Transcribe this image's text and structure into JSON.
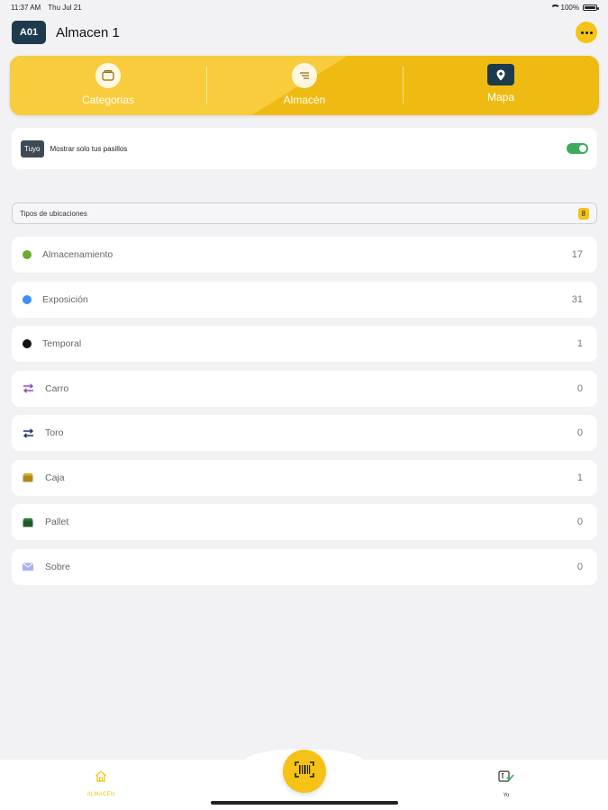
{
  "status_bar": {
    "time": "11:37 AM",
    "date": "Thu Jul 21",
    "battery": "100%"
  },
  "header": {
    "code": "A01",
    "title": "Almacen 1"
  },
  "tabs": [
    {
      "label": "Categorias",
      "icon": "wallet-icon"
    },
    {
      "label": "Almacén",
      "icon": "list-icon"
    },
    {
      "label": "Mapa",
      "icon": "map-pin-icon"
    }
  ],
  "filter": {
    "badge": "Tuyo",
    "label": "Mostrar solo tus pasillos",
    "enabled": true
  },
  "section": {
    "title": "Tipos de ubicaciones",
    "count": "8"
  },
  "location_types": [
    {
      "label": "Almacenamiento",
      "value": "17",
      "icon": "dot",
      "color": "#6aab2e"
    },
    {
      "label": "Exposición",
      "value": "31",
      "icon": "dot",
      "color": "#3d8ff0"
    },
    {
      "label": "Temporal",
      "value": "1",
      "icon": "dot",
      "color": "#111111"
    },
    {
      "label": "Carro",
      "value": "0",
      "icon": "swap-arrows-icon",
      "color": "#8a4fd1"
    },
    {
      "label": "Toro",
      "value": "0",
      "icon": "swap-arrows-icon",
      "color": "#23306b"
    },
    {
      "label": "Caja",
      "value": "1",
      "icon": "box-icon",
      "color": "#b28a1b"
    },
    {
      "label": "Pallet",
      "value": "0",
      "icon": "box-icon",
      "color": "#1f5a24"
    },
    {
      "label": "Sobre",
      "value": "0",
      "icon": "envelope-icon",
      "color": "#aab2f0"
    }
  ],
  "bottom_nav": {
    "home_label": "ALMACÉN",
    "me_label": "Yo"
  },
  "colors": {
    "accent": "#f4c316",
    "tab_bar": "#efbb12",
    "dark": "#1d3a4e",
    "toggle_on": "#3dab5a"
  }
}
